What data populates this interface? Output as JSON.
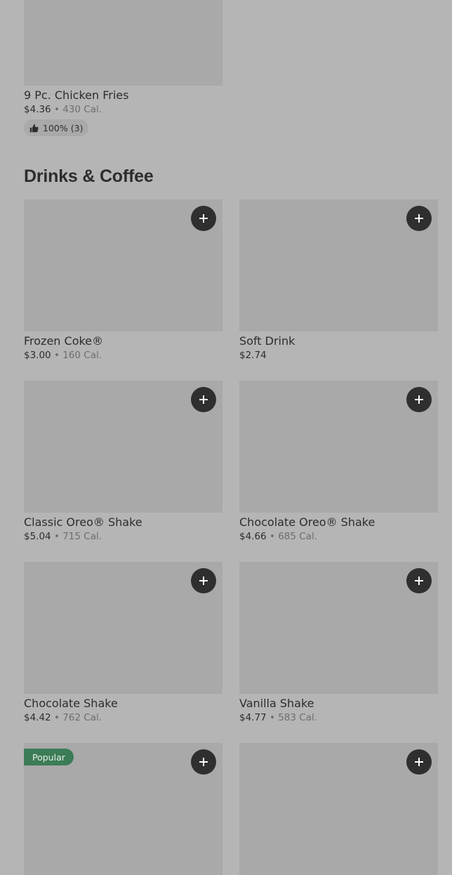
{
  "sections": {
    "drinks": {
      "title": "Drinks & Coffee"
    }
  },
  "items": {
    "chicken_fries": {
      "name": "9 Pc. Chicken Fries",
      "price": "$4.36",
      "separator": "•",
      "calories": "430 Cal.",
      "rating": "100% (3)",
      "rating_icon": "thumbs-up-icon"
    },
    "frozen_coke": {
      "name": "Frozen Coke®",
      "price": "$3.00",
      "separator": "•",
      "calories": "160 Cal."
    },
    "soft_drink": {
      "name": "Soft Drink",
      "price": "$2.74"
    },
    "classic_oreo": {
      "name": "Classic Oreo® Shake",
      "price": "$5.04",
      "separator": "•",
      "calories": "715 Cal."
    },
    "chocolate_oreo": {
      "name": "Chocolate Oreo® Shake",
      "price": "$4.66",
      "separator": "•",
      "calories": "685 Cal."
    },
    "chocolate_shake": {
      "name": "Chocolate Shake",
      "price": "$4.42",
      "separator": "•",
      "calories": "762 Cal."
    },
    "vanilla_shake": {
      "name": "Vanilla Shake",
      "price": "$4.77",
      "separator": "•",
      "calories": "583 Cal."
    },
    "popular_item": {
      "badge": "Popular"
    }
  },
  "icons": {
    "add": "plus-icon"
  },
  "colors": {
    "background": "#b5b5b5",
    "image_placeholder": "#a9a9a9",
    "add_button": "#2f2f2f",
    "popular_badge": "#3c7c57"
  }
}
